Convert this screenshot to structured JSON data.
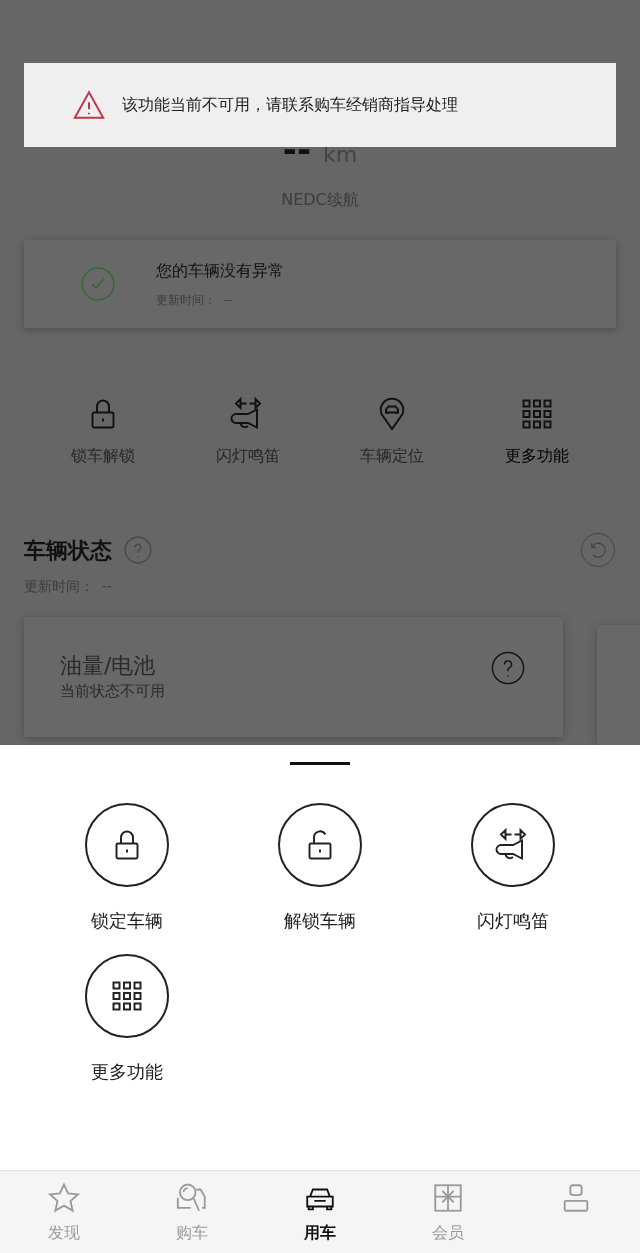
{
  "toast": {
    "kind": "warning",
    "text": "该功能当前不可用，请联系购车经销商指导处理"
  },
  "range": {
    "value": "--",
    "unit": "km",
    "label": "NEDC续航"
  },
  "health_card": {
    "title": "您的车辆没有异常",
    "update_label": "更新时间：",
    "update_value": "--"
  },
  "quick_actions": [
    {
      "label": "锁车解锁",
      "kind": "lock",
      "disabled": true
    },
    {
      "label": "闪灯鸣笛",
      "kind": "horn",
      "disabled": true
    },
    {
      "label": "车辆定位",
      "kind": "pin",
      "disabled": true
    },
    {
      "label": "更多功能",
      "kind": "grid",
      "disabled": false
    }
  ],
  "vehicle_status": {
    "title": "车辆状态",
    "update_label": "更新时间：",
    "update_value": "--",
    "cards": [
      {
        "title": "油量/电池",
        "subtitle": "当前状态不可用"
      }
    ]
  },
  "sheet": {
    "actions": [
      {
        "label": "锁定车辆",
        "kind": "lock"
      },
      {
        "label": "解锁车辆",
        "kind": "unlock"
      },
      {
        "label": "闪灯鸣笛",
        "kind": "horn"
      },
      {
        "label": "更多功能",
        "kind": "grid"
      }
    ]
  },
  "tab_bar": [
    {
      "label": "发现",
      "kind": "star",
      "selected": false
    },
    {
      "label": "购车",
      "kind": "search-car",
      "selected": false
    },
    {
      "label": "用车",
      "kind": "car",
      "selected": true
    },
    {
      "label": "会员",
      "kind": "gift",
      "selected": false
    },
    {
      "kind": "person",
      "selected": false
    }
  ]
}
